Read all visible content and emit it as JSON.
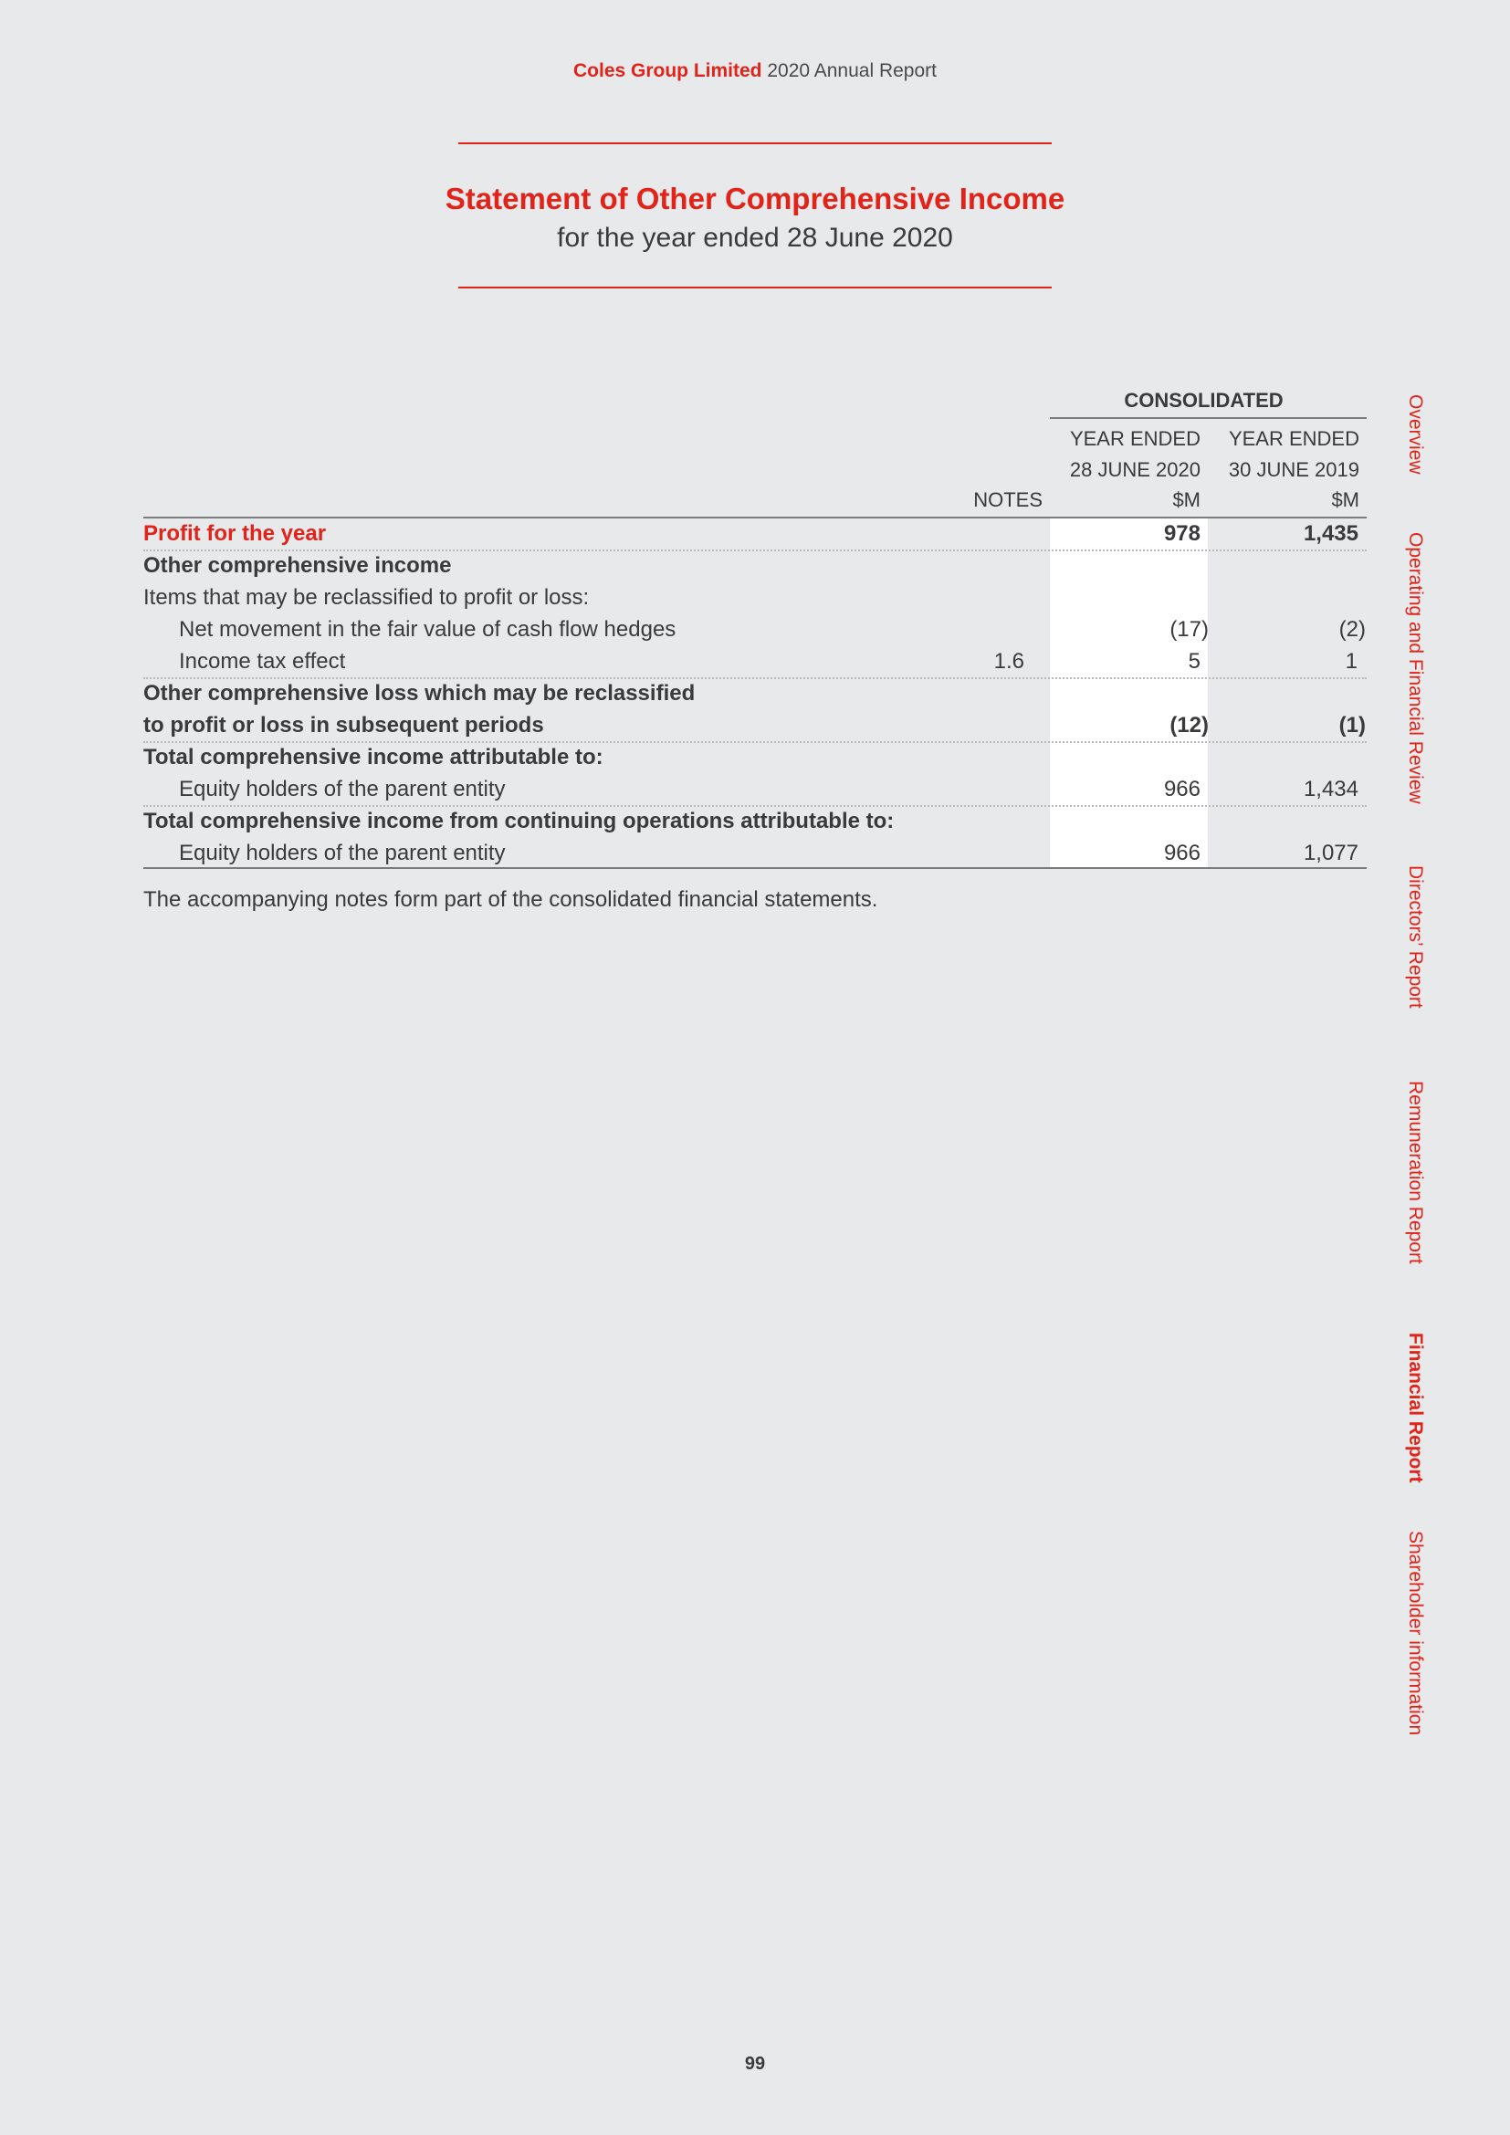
{
  "header": {
    "brand": "Coles Group Limited",
    "rest": " 2020 Annual Report"
  },
  "title": "Statement of Other Comprehensive Income",
  "subtitle": "for the year ended 28 June 2020",
  "table": {
    "group_header": "CONSOLIDATED",
    "notes_header": "NOTES",
    "col1": {
      "line1": "YEAR ENDED",
      "line2": "28 JUNE 2020",
      "unit": "$M"
    },
    "col2": {
      "line1": "YEAR ENDED",
      "line2": "30 JUNE 2019",
      "unit": "$M"
    },
    "rows": [
      {
        "label": "Profit for the year",
        "note": "",
        "v2020": "978",
        "v2019": "1,435"
      },
      {
        "label": "Other comprehensive income",
        "note": "",
        "v2020": "",
        "v2019": ""
      },
      {
        "label": "Items that may be reclassified to profit or loss:",
        "note": "",
        "v2020": "",
        "v2019": ""
      },
      {
        "label": "Net movement in the fair value of cash flow hedges",
        "note": "",
        "v2020": "(17)",
        "v2019": "(2)"
      },
      {
        "label": "Income tax effect",
        "note": "1.6",
        "v2020": "5",
        "v2019": "1"
      },
      {
        "label": "Other comprehensive loss which may be reclassified",
        "note": "",
        "v2020": "",
        "v2019": ""
      },
      {
        "label": "to profit or loss in subsequent periods",
        "note": "",
        "v2020": "(12)",
        "v2019": "(1)"
      },
      {
        "label": "Total comprehensive income attributable to:",
        "note": "",
        "v2020": "",
        "v2019": ""
      },
      {
        "label": "Equity holders of the parent entity",
        "note": "",
        "v2020": "966",
        "v2019": "1,434"
      },
      {
        "label": "Total comprehensive income from continuing operations attributable to:",
        "note": "",
        "v2020": "",
        "v2019": ""
      },
      {
        "label": "Equity holders of the parent entity",
        "note": "",
        "v2020": "966",
        "v2019": "1,077"
      }
    ]
  },
  "footnote": "The accompanying notes form part of the consolidated financial statements.",
  "page_number": "99",
  "side_nav": [
    {
      "label": "Overview",
      "active": false
    },
    {
      "label": "Operating and Financial Review",
      "active": false
    },
    {
      "label": "Directors’ Report",
      "active": false
    },
    {
      "label": "Remuneration Report",
      "active": false
    },
    {
      "label": "Financial Report",
      "active": true
    },
    {
      "label": "Shareholder information",
      "active": false
    }
  ],
  "colors": {
    "accent": "#e2231a",
    "text": "#3a3a3c",
    "background": "#e8e9ea"
  }
}
